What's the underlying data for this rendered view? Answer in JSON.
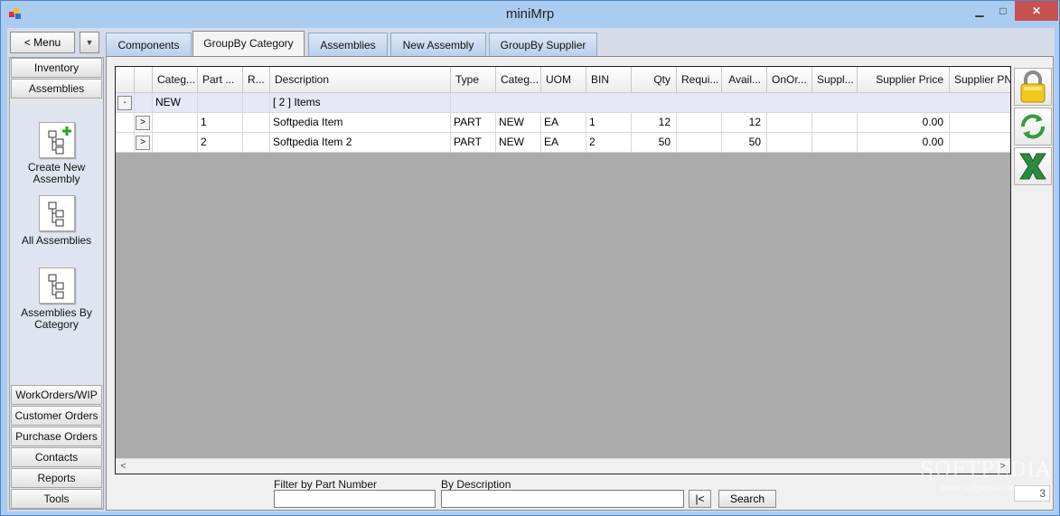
{
  "window": {
    "title": "miniMrp",
    "minimize": "▁",
    "maximize": "□",
    "close": "✕"
  },
  "menu": {
    "label": "< Menu",
    "drop": "▼"
  },
  "nav": {
    "top_buttons": [
      "Inventory",
      "Assemblies"
    ],
    "items": [
      {
        "label": "Create New Assembly",
        "icon": "create-assembly-icon"
      },
      {
        "label": "All Assemblies",
        "icon": "all-assemblies-icon"
      },
      {
        "label": "Assemblies By Category",
        "icon": "assemblies-category-icon"
      }
    ],
    "bottom_buttons": [
      "WorkOrders/WIP",
      "Customer Orders",
      "Purchase Orders",
      "Contacts",
      "Reports",
      "Tools"
    ]
  },
  "tabs": [
    {
      "label": "Components",
      "active": false
    },
    {
      "label": "GroupBy Category",
      "active": true
    },
    {
      "label": "Assemblies",
      "active": false
    },
    {
      "label": "New Assembly",
      "active": false
    },
    {
      "label": "GroupBy Supplier",
      "active": false
    }
  ],
  "grid": {
    "columns": [
      "",
      "",
      "Categ...",
      "Part ...",
      "R...",
      "Description",
      "Type",
      "Categ...",
      "UOM",
      "BIN",
      "Qty",
      "Requi...",
      "Avail...",
      "OnOr...",
      "Suppl...",
      "Supplier Price",
      "Supplier PNo"
    ],
    "group": {
      "toggle": "-",
      "category": "NEW",
      "description": "[ 2 ] Items"
    },
    "rows": [
      {
        "expand": ">",
        "part": "1",
        "description": "Softpedia Item",
        "type": "PART",
        "category": "NEW",
        "uom": "EA",
        "bin": "1",
        "qty": "12",
        "available": "12",
        "supplier_price": "0.00"
      },
      {
        "expand": ">",
        "part": "2",
        "description": "Softpedia Item 2",
        "type": "PART",
        "category": "NEW",
        "uom": "EA",
        "bin": "2",
        "qty": "50",
        "available": "50",
        "supplier_price": "0.00"
      }
    ],
    "scroll_left": "<",
    "scroll_right": ">"
  },
  "side_buttons": [
    "lock-icon",
    "refresh-icon",
    "excel-icon"
  ],
  "counter": "3",
  "filters": {
    "part_label": "Filter by Part Number",
    "part_value": "",
    "desc_label": "By Description",
    "desc_value": "",
    "first_button": "|<",
    "search_button": "Search"
  },
  "watermark": {
    "text": "SOFTPEDIA",
    "url": "www.softpedia.com"
  },
  "colors": {
    "titlebar": "#aaccf0",
    "close": "#c75050",
    "group_row": "#e6e8f8",
    "grid_bg": "#ababab"
  }
}
